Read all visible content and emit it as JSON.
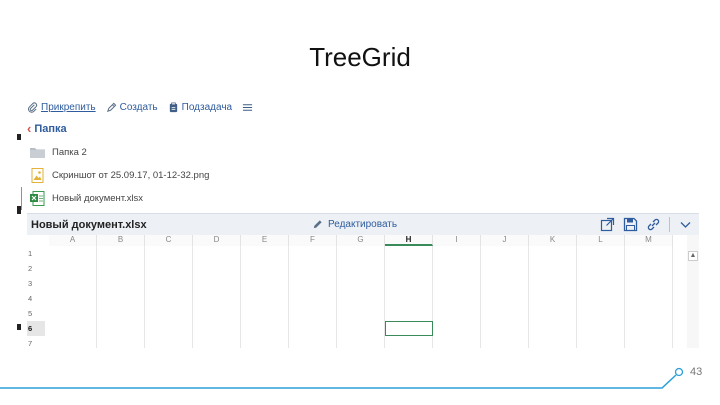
{
  "slide": {
    "title": "TreeGrid",
    "page_number": "43"
  },
  "toolbar": {
    "items": [
      {
        "label": "Прикрепить",
        "icon": "paperclip-icon"
      },
      {
        "label": "Создать",
        "icon": "create-icon"
      },
      {
        "label": "Подзадача",
        "icon": "subtask-icon"
      }
    ],
    "menu_icon": "hamburger-icon"
  },
  "breadcrumb": {
    "label": "Папка"
  },
  "files": [
    {
      "name": "Папка 2",
      "icon": "folder-icon"
    },
    {
      "name": "Скриншот от 25.09.17, 01-12-32.png",
      "icon": "image-file-icon"
    },
    {
      "name": "Новый документ.xlsx",
      "icon": "excel-file-icon"
    }
  ],
  "sheet": {
    "title": "Новый документ.xlsx",
    "edit_label": "Редактировать",
    "columns": [
      "A",
      "B",
      "C",
      "D",
      "E",
      "F",
      "G",
      "H",
      "I",
      "J",
      "K",
      "L",
      "M"
    ],
    "selected_column": "H",
    "rows": [
      "1",
      "2",
      "3",
      "4",
      "5",
      "6",
      "7"
    ],
    "selected_row": "6"
  },
  "colors": {
    "accent": "#2f5c9e",
    "active_file": "#e07a3a",
    "selection": "#3b8a5a",
    "footer_line": "#2b9fd8"
  }
}
